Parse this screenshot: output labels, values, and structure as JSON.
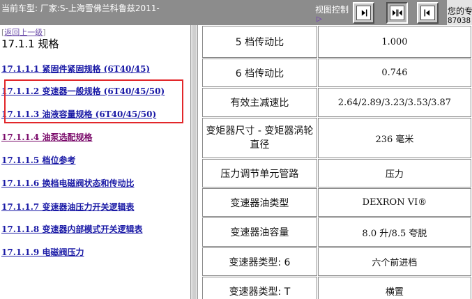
{
  "header": {
    "current_model": "当前车型:  厂家:S-上海雪佛兰科鲁兹2011-",
    "view_control_label": "视图控制",
    "view_control_marker": "▷",
    "right_text_line1": "您的专",
    "right_text_line2": "87038"
  },
  "view_buttons": [
    {
      "icon": "expand-right-icon"
    },
    {
      "icon": "center-split-icon"
    },
    {
      "icon": "collapse-left-icon"
    }
  ],
  "toc": {
    "back_bracket_open": "[",
    "back_link": "返回上一级",
    "back_bracket_close": "]",
    "section_title": "17.1.1 规格",
    "items": [
      {
        "label": "17.1.1.1 紧固件紧固规格 (6T40/45)"
      },
      {
        "label": "17.1.1.2 变速器一般规格 (6T40/45/50)"
      },
      {
        "label": "17.1.1.3 油液容量规格 (6T40/45/50)"
      },
      {
        "label": "17.1.1.4 油泵选配规格"
      },
      {
        "label": "17.1.1.5 档位参考"
      },
      {
        "label": "17.1.1.6 换档电磁阀状态和传动比"
      },
      {
        "label": "17.1.1.7 变速器油压力开关逻辑表"
      },
      {
        "label": "17.1.1.8 变速器内部模式开关逻辑表"
      },
      {
        "label": "17.1.1.9 电磁阀压力"
      }
    ]
  },
  "spec_table": {
    "rows": [
      {
        "param": "5 档传动比",
        "value": "1.000"
      },
      {
        "param": "6 档传动比",
        "value": "0.746"
      },
      {
        "param": "有效主减速比",
        "value": "2.64/2.89/3.23/3.53/3.87"
      },
      {
        "param": "变矩器尺寸 - 变矩器涡轮直径",
        "value": "236  毫米"
      },
      {
        "param": "压力调节单元管路",
        "value": "压力"
      },
      {
        "param": "变速器油类型",
        "value": "DEXRON VI®"
      },
      {
        "param": "变速器油容量",
        "value": "8.0  升/8.5  夸脱"
      },
      {
        "param": "变速器类型: 6",
        "value": "六个前进档"
      },
      {
        "param": "变速器类型: T",
        "value": "横置"
      }
    ]
  },
  "colors": {
    "header_bg": "#8c8c8c",
    "link": "#1a1aa6",
    "visited_link": "#7a0a6a",
    "highlight_border": "#e2272a"
  }
}
